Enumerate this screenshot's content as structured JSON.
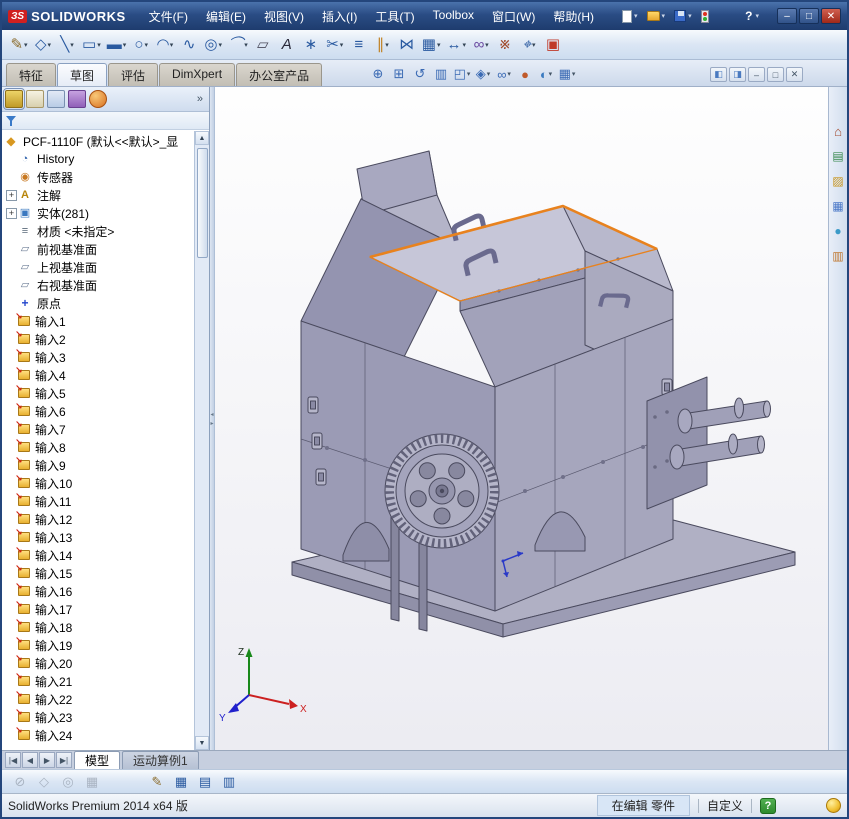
{
  "titlebar": {
    "logo_mark": "ЗS",
    "logo_text": "SOLIDWORKS",
    "menus": [
      "文件(F)",
      "编辑(E)",
      "视图(V)",
      "插入(I)",
      "工具(T)",
      "Toolbox",
      "窗口(W)",
      "帮助(H)"
    ],
    "quick_buttons": [
      {
        "name": "new-document-button",
        "icon": "page",
        "dropdown": true
      },
      {
        "name": "open-document-button",
        "icon": "folder",
        "dropdown": true
      },
      {
        "name": "save-button",
        "icon": "disk",
        "dropdown": true
      },
      {
        "name": "rebuild-button",
        "icon": "traffic",
        "dropdown": false
      }
    ],
    "help_label": "?",
    "window_buttons": [
      {
        "name": "minimize-app-button",
        "glyph": "–"
      },
      {
        "name": "maximize-app-button",
        "glyph": "□"
      },
      {
        "name": "close-app-button",
        "glyph": "✕"
      }
    ]
  },
  "sketch_toolbar": {
    "items": [
      {
        "name": "sketch-tool",
        "glyph": "✎",
        "dropdown": true,
        "color": "#8a6a2a"
      },
      {
        "name": "smart-dimension-tool",
        "glyph": "◇",
        "dropdown": true
      },
      {
        "name": "line-tool",
        "glyph": "╲",
        "dropdown": true
      },
      {
        "name": "corner-rectangle-tool",
        "glyph": "▭",
        "dropdown": true
      },
      {
        "name": "straight-slot-tool",
        "glyph": "▬",
        "dropdown": true
      },
      {
        "name": "circle-tool",
        "glyph": "○",
        "dropdown": true
      },
      {
        "name": "centerpoint-arc-tool",
        "glyph": "◠",
        "dropdown": true
      },
      {
        "name": "spline-tool",
        "glyph": "∿",
        "dropdown": false
      },
      {
        "name": "ellipse-tool",
        "glyph": "◎",
        "dropdown": true
      },
      {
        "name": "sketch-fillet-tool",
        "glyph": "⌒",
        "dropdown": true
      },
      {
        "name": "plane-tool",
        "glyph": "▱",
        "dropdown": false,
        "color": "#4a4a5a"
      },
      {
        "name": "text-tool",
        "glyph": "A",
        "dropdown": false,
        "color": "#2a2a3a"
      },
      {
        "name": "point-tool",
        "glyph": "∗",
        "dropdown": false
      },
      {
        "name": "trim-entities-tool",
        "glyph": "✂",
        "dropdown": true
      },
      {
        "name": "convert-entities-tool",
        "glyph": "≡",
        "dropdown": false
      },
      {
        "name": "offset-entities-tool",
        "glyph": "∥",
        "dropdown": true,
        "color": "#c08020"
      },
      {
        "name": "mirror-entities-tool",
        "glyph": "⋈",
        "dropdown": false
      },
      {
        "name": "linear-sketch-pattern-tool",
        "glyph": "▦",
        "dropdown": true
      },
      {
        "name": "move-entities-tool",
        "glyph": "↔",
        "dropdown": true
      },
      {
        "name": "display-relations-tool",
        "glyph": "∞",
        "dropdown": true,
        "color": "#6a4aa0"
      },
      {
        "name": "repair-sketch-tool",
        "glyph": "※",
        "dropdown": false,
        "color": "#a04a2a"
      },
      {
        "name": "quick-snaps-tool",
        "glyph": "⌖",
        "dropdown": true
      },
      {
        "name": "rapid-sketch-tool",
        "glyph": "▣",
        "dropdown": false,
        "color": "#c03a2a"
      }
    ]
  },
  "command_manager": {
    "tabs": [
      {
        "label": "特征",
        "name": "tab-features"
      },
      {
        "label": "草图",
        "name": "tab-sketch",
        "active": true
      },
      {
        "label": "评估",
        "name": "tab-evaluate"
      },
      {
        "label": "DimXpert",
        "name": "tab-dimxpert"
      },
      {
        "label": "办公室产品",
        "name": "tab-office-products"
      }
    ]
  },
  "view_toolbar": {
    "items": [
      {
        "name": "zoom-to-fit-button",
        "glyph": "⊕"
      },
      {
        "name": "zoom-to-area-button",
        "glyph": "⊞"
      },
      {
        "name": "previous-view-button",
        "glyph": "↺"
      },
      {
        "name": "section-view-button",
        "glyph": "▥"
      },
      {
        "name": "view-orientation-button",
        "glyph": "◰",
        "dropdown": true
      },
      {
        "name": "display-style-button",
        "glyph": "◈",
        "dropdown": true
      },
      {
        "name": "hide-show-items-button",
        "glyph": "∞",
        "dropdown": true
      },
      {
        "name": "edit-appearance-button",
        "glyph": "●",
        "color": "#c05a2a"
      },
      {
        "name": "apply-scene-button",
        "glyph": "◐",
        "dropdown": true,
        "color": "#3a7ac0"
      },
      {
        "name": "view-settings-button",
        "glyph": "▦",
        "dropdown": true
      }
    ]
  },
  "pane_buttons": [
    {
      "name": "display-pane-left-button",
      "glyph": "◧",
      "color": "#4a7ac0"
    },
    {
      "name": "display-pane-right-button",
      "glyph": "◨",
      "color": "#4a7ac0"
    },
    {
      "name": "minimize-doc-button",
      "glyph": "–"
    },
    {
      "name": "restore-doc-button",
      "glyph": "□"
    },
    {
      "name": "close-doc-button",
      "glyph": "✕"
    }
  ],
  "feature_panel": {
    "manager_tabs": [
      {
        "name": "feature-manager-tab",
        "icon": "feature-manager",
        "active": true
      },
      {
        "name": "property-manager-tab",
        "icon": "property-manager"
      },
      {
        "name": "configuration-manager-tab",
        "icon": "configuration-manager"
      },
      {
        "name": "dimxpert-manager-tab",
        "icon": "dimxpert-manager"
      },
      {
        "name": "display-manager-tab",
        "icon": "display-manager"
      }
    ],
    "more_chevron": "»",
    "root_label": "PCF-1110F (默认<<默认>_显",
    "items": [
      {
        "label": "History",
        "icon": "history"
      },
      {
        "label": "传感器",
        "icon": "sensors"
      },
      {
        "label": "注解",
        "icon": "annotations",
        "expander": true
      },
      {
        "label": "实体(281)",
        "icon": "bodies",
        "expander": true
      },
      {
        "label": "材质 <未指定>",
        "icon": "material"
      },
      {
        "label": "前视基准面",
        "icon": "plane"
      },
      {
        "label": "上视基准面",
        "icon": "plane"
      },
      {
        "label": "右视基准面",
        "icon": "plane"
      },
      {
        "label": "原点",
        "icon": "origin"
      }
    ],
    "inputs": [
      "输入1",
      "输入2",
      "输入3",
      "输入4",
      "输入5",
      "输入6",
      "输入7",
      "输入8",
      "输入9",
      "输入10",
      "输入11",
      "输入12",
      "输入13",
      "输入14",
      "输入15",
      "输入16",
      "输入17",
      "输入18",
      "输入19",
      "输入20",
      "输入21",
      "输入22",
      "输入23",
      "输入24"
    ],
    "scroll_up": "▲",
    "scroll_down": "▼"
  },
  "splitter": {
    "collapse": "◂",
    "expand": "▸"
  },
  "viewport": {
    "triad": {
      "x": "X",
      "y": "Y",
      "z": "Z"
    },
    "model_color": "#a0a0ba",
    "highlight_color": "#e8821e"
  },
  "task_pane": {
    "icons": [
      {
        "name": "solidworks-resources-icon",
        "icon": "home"
      },
      {
        "name": "design-library-icon",
        "icon": "design-library"
      },
      {
        "name": "file-explorer-icon",
        "icon": "file-explorer"
      },
      {
        "name": "view-palette-icon",
        "icon": "view-palette"
      },
      {
        "name": "appearances-icon",
        "icon": "appearances"
      },
      {
        "name": "custom-properties-icon",
        "icon": "custom-properties"
      }
    ]
  },
  "doc_tabs": {
    "nav": [
      "|◀",
      "◀",
      "▶",
      "▶|"
    ],
    "tabs": [
      {
        "label": "模型",
        "name": "model-tab",
        "active": true
      },
      {
        "label": "运动算例1",
        "name": "motion-study-tab"
      }
    ]
  },
  "bottom_toolbar": {
    "items": [
      {
        "name": "snap-filter-button",
        "glyph": "⊘",
        "disabled": true
      },
      {
        "name": "snap-vertex-button",
        "glyph": "◇",
        "disabled": true
      },
      {
        "name": "snap-center-button",
        "glyph": "◎",
        "disabled": true
      },
      {
        "name": "snap-grid-button",
        "glyph": "▦",
        "disabled": true
      },
      {
        "name": "sketch-button",
        "glyph": "✎",
        "color": "#8a6a2a"
      },
      {
        "name": "grid-settings-button",
        "glyph": "▦",
        "color": "#2a5aa0"
      },
      {
        "name": "layer-properties-button",
        "glyph": "▤",
        "color": "#2a5aa0"
      },
      {
        "name": "tables-button",
        "glyph": "▥",
        "color": "#2a5aa0"
      }
    ]
  },
  "statusbar": {
    "product": "SolidWorks Premium 2014 x64 版",
    "editing": "在编辑 零件",
    "custom": "自定义",
    "help": "?"
  }
}
